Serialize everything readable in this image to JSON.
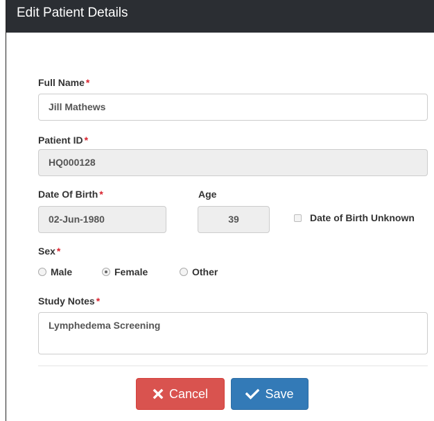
{
  "modal": {
    "title": "Edit Patient Details"
  },
  "form": {
    "full_name": {
      "label": "Full Name",
      "required": "*",
      "value": "Jill Mathews"
    },
    "patient_id": {
      "label": "Patient ID",
      "required": "*",
      "value": "HQ000128"
    },
    "dob": {
      "label": "Date Of Birth",
      "required": "*",
      "value": "02-Jun-1980"
    },
    "age": {
      "label": "Age",
      "value": "39"
    },
    "dob_unknown": {
      "label": "Date of Birth Unknown",
      "checked": false
    },
    "sex": {
      "label": "Sex",
      "required": "*",
      "options": [
        {
          "label": "Male",
          "checked": false
        },
        {
          "label": "Female",
          "checked": true
        },
        {
          "label": "Other",
          "checked": false
        }
      ]
    },
    "study_notes": {
      "label": "Study Notes",
      "required": "*",
      "value": "Lymphedema Screening"
    }
  },
  "buttons": {
    "cancel_label": "Cancel",
    "save_label": "Save"
  },
  "colors": {
    "header_bg": "#2b2e33",
    "required_star": "#d9232e",
    "cancel_bg": "#d9534f",
    "save_bg": "#337ab7"
  }
}
